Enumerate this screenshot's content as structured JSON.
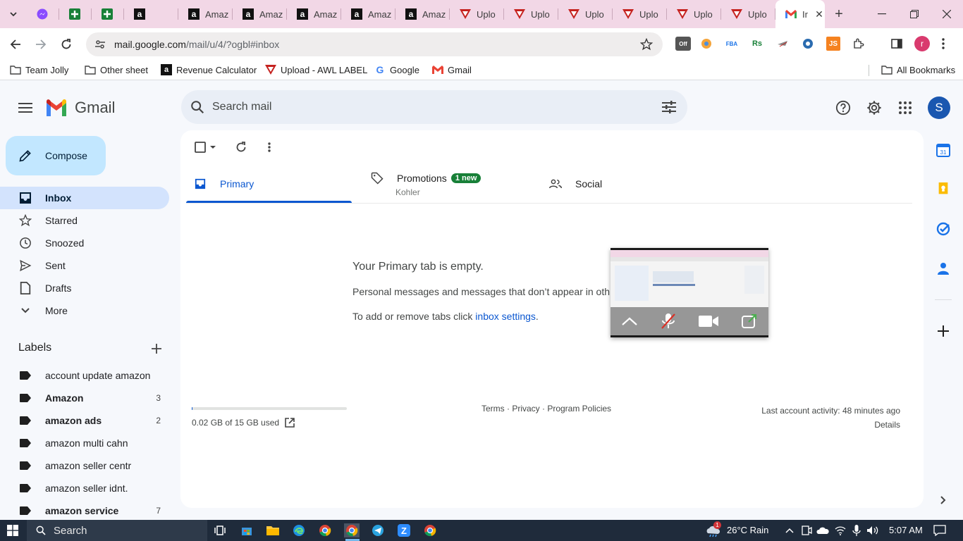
{
  "browser": {
    "tabs": [
      {
        "title": "",
        "icon": "messenger-icon",
        "color": "#8a4cff"
      },
      {
        "title": "",
        "icon": "sheets-plus-icon",
        "color": "#188038"
      },
      {
        "title": "",
        "icon": "sheets-plus-icon",
        "color": "#188038"
      },
      {
        "title": "",
        "icon": "amazon-icon",
        "color": "#111111"
      },
      {
        "title": "Amaz",
        "icon": "amazon-icon",
        "color": "#111111"
      },
      {
        "title": "Amaz",
        "icon": "amazon-icon",
        "color": "#111111"
      },
      {
        "title": "Amaz",
        "icon": "amazon-icon",
        "color": "#111111"
      },
      {
        "title": "Amaz",
        "icon": "amazon-icon",
        "color": "#111111"
      },
      {
        "title": "Amaz",
        "icon": "amazon-icon",
        "color": "#111111"
      },
      {
        "title": "Uplo",
        "icon": "upload-icon",
        "color": "#c5221f"
      },
      {
        "title": "Uplo",
        "icon": "upload-icon",
        "color": "#c5221f"
      },
      {
        "title": "Uplo",
        "icon": "upload-icon",
        "color": "#c5221f"
      },
      {
        "title": "Uplo",
        "icon": "upload-icon",
        "color": "#c5221f"
      },
      {
        "title": "Uplo",
        "icon": "upload-icon",
        "color": "#c5221f"
      },
      {
        "title": "Uplo",
        "icon": "upload-icon",
        "color": "#c5221f"
      }
    ],
    "active_tab": {
      "title": "Ir",
      "icon": "gmail-icon"
    },
    "new_tab_label": "+",
    "url": {
      "host": "mail.google.com",
      "path": "/mail/u/4/?ogbl#inbox"
    },
    "extensions": [
      "Off",
      "FBA",
      "Rs",
      "JS"
    ],
    "profile_initial": "r",
    "bookmarks": [
      {
        "label": "Team Jolly",
        "icon": "folder-icon"
      },
      {
        "label": "Other sheet",
        "icon": "folder-icon"
      },
      {
        "label": "Revenue Calculator",
        "icon": "amazon-icon"
      },
      {
        "label": "Upload - AWL LABEL",
        "icon": "upload-icon"
      },
      {
        "label": "Google",
        "icon": "google-icon"
      },
      {
        "label": "Gmail",
        "icon": "gmail-icon"
      }
    ],
    "all_bookmarks": "All Bookmarks"
  },
  "gmail": {
    "logo_text": "Gmail",
    "search_placeholder": "Search mail",
    "avatar_initial": "S",
    "compose_label": "Compose",
    "nav": [
      {
        "label": "Inbox",
        "icon": "inbox-icon"
      },
      {
        "label": "Starred",
        "icon": "star-icon"
      },
      {
        "label": "Snoozed",
        "icon": "clock-icon"
      },
      {
        "label": "Sent",
        "icon": "send-icon"
      },
      {
        "label": "Drafts",
        "icon": "draft-icon"
      },
      {
        "label": "More",
        "icon": "chevron-down-icon"
      }
    ],
    "labels_title": "Labels",
    "labels": [
      {
        "name": "account update amazon",
        "count": "",
        "bold": false
      },
      {
        "name": "Amazon",
        "count": "3",
        "bold": true
      },
      {
        "name": "amazon ads",
        "count": "2",
        "bold": true
      },
      {
        "name": "amazon multi cahn",
        "count": "",
        "bold": false
      },
      {
        "name": "amazon seller centr",
        "count": "",
        "bold": false
      },
      {
        "name": "amazon seller idnt.",
        "count": "",
        "bold": false
      },
      {
        "name": "amazon service",
        "count": "7",
        "bold": true
      }
    ],
    "tabs": {
      "primary": "Primary",
      "promotions": "Promotions",
      "promotions_badge": "1 new",
      "promotions_sub": "Kohler",
      "social": "Social"
    },
    "empty": {
      "title": "Your Primary tab is empty.",
      "line1": "Personal messages and messages that don’t appear in oth",
      "line2_prefix": "To add or remove tabs click ",
      "line2_link": "inbox settings",
      "line2_suffix": "."
    },
    "footer": {
      "storage": "0.02 GB of 15 GB used",
      "storage_fraction": 0.0013,
      "links": "Terms · Privacy · Program Policies",
      "activity": "Last account activity: 48 minutes ago",
      "details": "Details"
    },
    "colors": {
      "accent": "#0b57d0",
      "compose_bg": "#c2e7ff",
      "active_nav": "#d3e3fd",
      "badge": "#188038"
    }
  },
  "taskbar": {
    "search_label": "Search",
    "weather": "26°C  Rain",
    "weather_badge": "1",
    "time": "5:07 AM"
  }
}
